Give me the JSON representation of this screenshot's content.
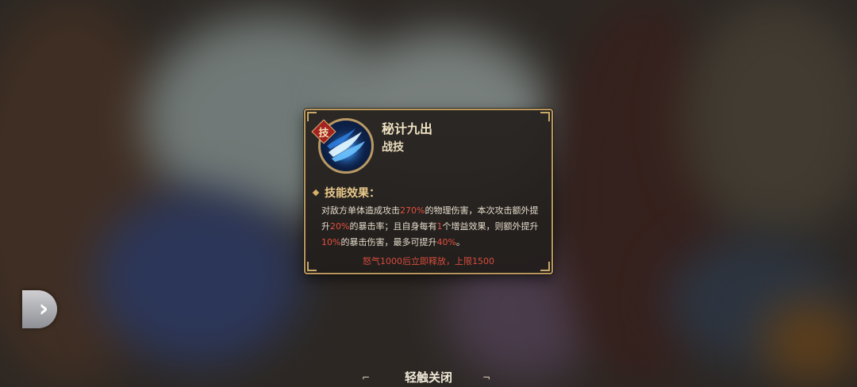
{
  "tooltip": {
    "badge": "技",
    "skill_name": "秘计九出",
    "skill_type": "战技",
    "section_title": "技能效果：",
    "description": [
      {
        "text": "对敌方单体造成攻击",
        "hl": false
      },
      {
        "text": "270%",
        "hl": true
      },
      {
        "text": "的物理伤害，本次攻击额外提升",
        "hl": false
      },
      {
        "text": "20%",
        "hl": true
      },
      {
        "text": "的暴击率；且自身每有",
        "hl": false
      },
      {
        "text": "1",
        "hl": true
      },
      {
        "text": "个增益效果，则额外提升",
        "hl": false
      },
      {
        "text": "10%",
        "hl": true
      },
      {
        "text": "的暴击伤害，最多可提升",
        "hl": false
      },
      {
        "text": "40%",
        "hl": true
      },
      {
        "text": "。",
        "hl": false
      }
    ],
    "footnote": "怒气1000后立即释放，上限1500"
  },
  "close_hint": {
    "label": "轻触关闭"
  },
  "icons": {
    "side_arrow": "chevron-right-icon",
    "skill": "blue-slash-skill-icon"
  },
  "colors": {
    "highlight": "#e2503f",
    "border_gold": "#b8965c",
    "title": "#f0e3c2"
  }
}
